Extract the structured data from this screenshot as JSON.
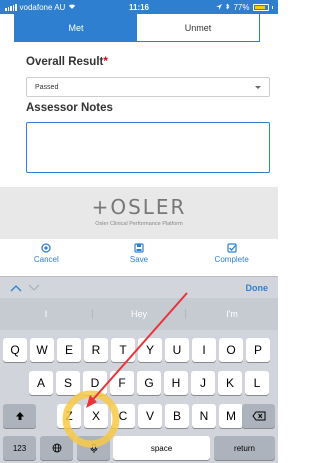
{
  "status_bar": {
    "carrier": "vodafone AU",
    "time": "11:16",
    "battery": "77%"
  },
  "toggle": {
    "met": "Met",
    "unmet": "Unmet"
  },
  "form": {
    "overall_result_label": "Overall Result",
    "required_marker": "*",
    "overall_result_value": "Passed",
    "assessor_notes_label": "Assessor Notes",
    "assessor_notes_value": ""
  },
  "branding": {
    "logo": "+OSLER",
    "tagline": "Osler Clinical Performance Platform"
  },
  "actions": {
    "cancel": "Cancel",
    "save": "Save",
    "complete": "Complete"
  },
  "accessory": {
    "done": "Done"
  },
  "suggestions": [
    "I",
    "Hey",
    "I'm"
  ],
  "keyboard": {
    "row1": [
      "Q",
      "W",
      "E",
      "R",
      "T",
      "Y",
      "U",
      "I",
      "O",
      "P"
    ],
    "row2": [
      "A",
      "S",
      "D",
      "F",
      "G",
      "H",
      "J",
      "K",
      "L"
    ],
    "row3": [
      "Z",
      "X",
      "C",
      "V",
      "B",
      "N",
      "M"
    ],
    "numbers": "123",
    "space": "space",
    "return": "return"
  },
  "colors": {
    "accent": "#2f7fd1",
    "required": "#d0021b",
    "annotation_arrow": "#e8343a",
    "annotation_circle": "#f7c948"
  }
}
